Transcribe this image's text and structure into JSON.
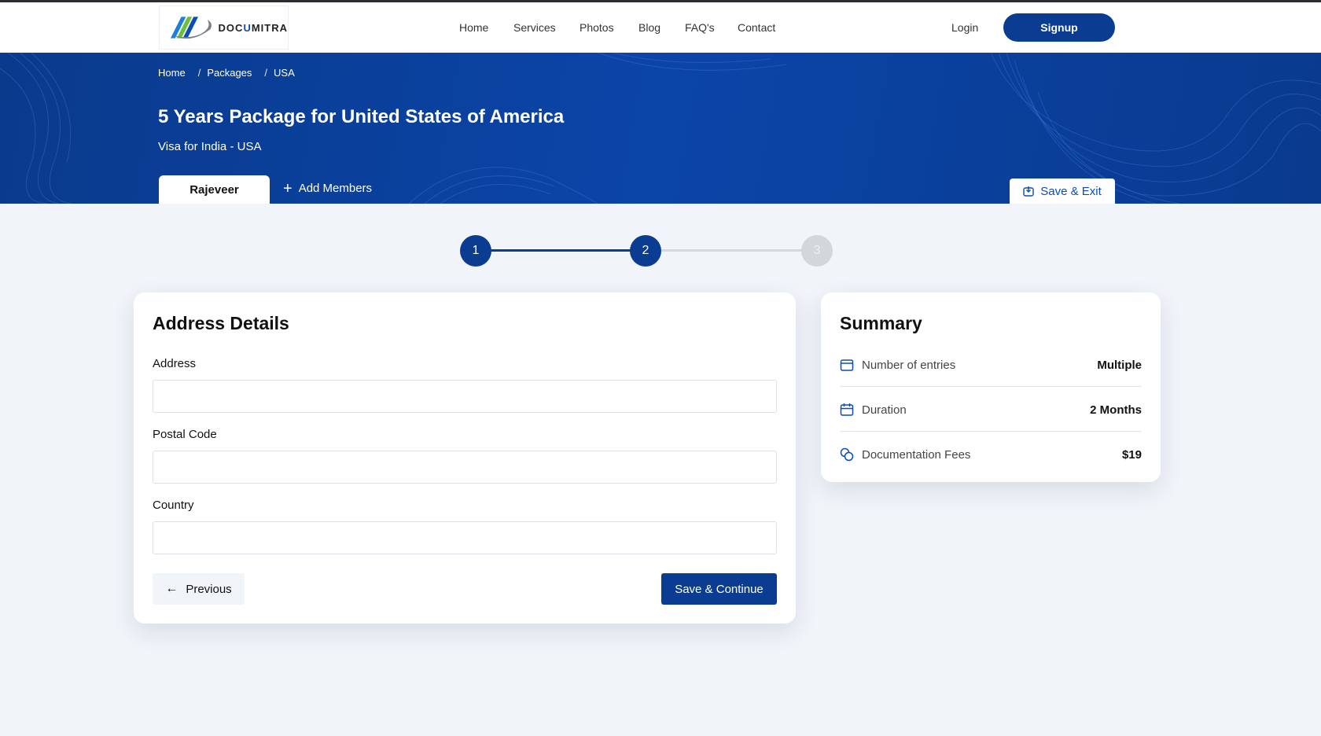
{
  "brand": {
    "name_prefix": "DOC",
    "name_accent": "U",
    "name_suffix": "MITRA",
    "accent_color": "#0b4db4",
    "primary_color": "#0a3d91"
  },
  "nav": {
    "items": [
      "Home",
      "Services",
      "Photos",
      "Blog",
      "FAQ's",
      "Contact"
    ],
    "login": "Login",
    "signup": "Signup"
  },
  "breadcrumb": [
    "Home",
    "Packages",
    "USA"
  ],
  "hero": {
    "title": "5 Years Package for United States of America",
    "subtitle": "Visa for India - USA",
    "member_tab": "Rajeveer",
    "add_members": "Add Members",
    "save_exit": "Save & Exit"
  },
  "stepper": {
    "steps": [
      "1",
      "2",
      "3"
    ],
    "current": 2
  },
  "form": {
    "title": "Address Details",
    "fields": [
      {
        "label": "Address",
        "value": "",
        "placeholder": ""
      },
      {
        "label": "Postal Code",
        "value": "",
        "placeholder": ""
      },
      {
        "label": "Country",
        "value": "",
        "placeholder": ""
      }
    ],
    "previous": "Previous",
    "continue": "Save & Continue"
  },
  "summary": {
    "title": "Summary",
    "rows": [
      {
        "icon": "ticket-icon",
        "label": "Number of entries",
        "value": "Multiple"
      },
      {
        "icon": "calendar-icon",
        "label": "Duration",
        "value": "2 Months"
      },
      {
        "icon": "coins-icon",
        "label": "Documentation Fees",
        "value": "$19"
      }
    ]
  }
}
